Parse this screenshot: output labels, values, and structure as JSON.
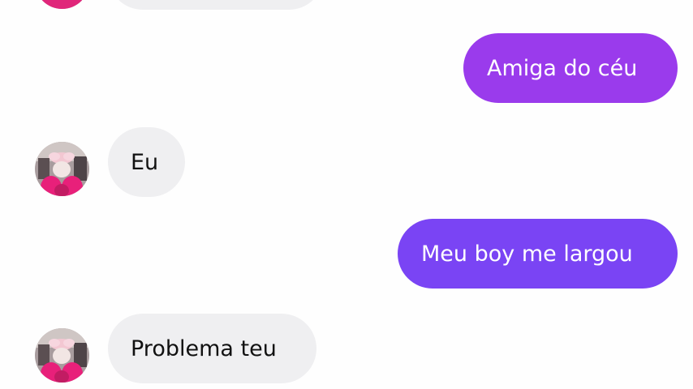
{
  "colors": {
    "incoming_bubble": "#efeff1",
    "incoming_text": "#111111",
    "outgoing_bubble_top": "#9a3bec",
    "outgoing_bubble_mid": "#8a3df1",
    "outgoing_bubble_bottom": "#7a44f4",
    "outgoing_text": "#ffffff",
    "background": "#fefefe"
  },
  "messages": [
    {
      "direction": "incoming",
      "text": ""
    },
    {
      "direction": "outgoing",
      "text": "Amiga do céu"
    },
    {
      "direction": "incoming",
      "text": "Eu",
      "avatar": "contact-avatar"
    },
    {
      "direction": "outgoing",
      "text": "Meu boy me largou"
    },
    {
      "direction": "incoming",
      "text": "Problema teu",
      "avatar": "contact-avatar"
    }
  ]
}
